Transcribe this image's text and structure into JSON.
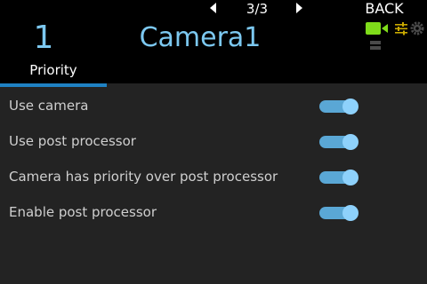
{
  "topbar": {
    "page_indicator": "3/3",
    "back_label": "BACK"
  },
  "header": {
    "camera_number": "1",
    "camera_name": "Camera1",
    "accent_color": "#7cc8f0",
    "icons": [
      "camera-icon",
      "sliders-icon",
      "gear-icon",
      "list-icon"
    ],
    "active_icon_color": "#7fdc1a"
  },
  "tabs": [
    {
      "label": "Priority",
      "active": true
    }
  ],
  "settings": [
    {
      "label": "Use camera",
      "enabled": true
    },
    {
      "label": "Use post processor",
      "enabled": true
    },
    {
      "label": "Camera has priority over post processor",
      "enabled": true
    },
    {
      "label": "Enable post processor",
      "enabled": true
    }
  ]
}
